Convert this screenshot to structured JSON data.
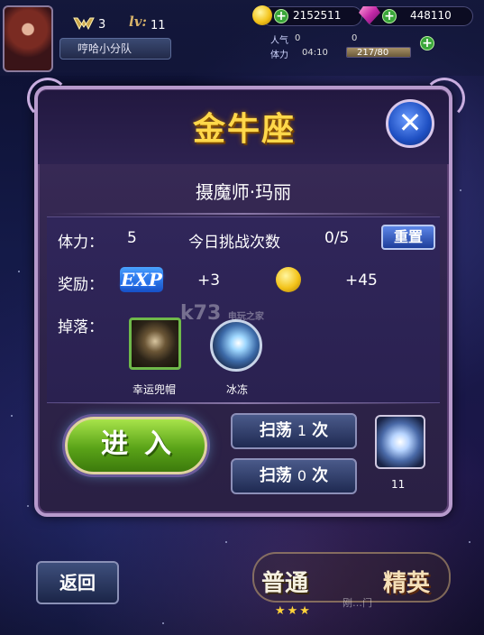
{
  "player": {
    "vip": "3",
    "level_label": "lv:",
    "level": "11",
    "team_name": "哼哈小分队"
  },
  "resources": {
    "gold": "2152511",
    "gems": "448110",
    "popularity_label": "人气",
    "popularity": "0",
    "popularity_extra": "0",
    "stamina_label": "体力",
    "stamina_timer": "04:10",
    "stamina": "217/80",
    "stamina_fill_fraction": 1.0
  },
  "dialog": {
    "title": "金牛座",
    "character": "摄魔师·玛丽",
    "stamina_label": "体力：",
    "stamina_cost": "5",
    "challenges_label": "今日挑战次数",
    "challenges_value": "0/5",
    "reset_button": "重置",
    "reward_label": "奖励：",
    "exp_icon_text": "EXP",
    "exp_value": "+3",
    "gold_value": "+45",
    "drops_label": "掉落：",
    "drops": [
      {
        "name": "幸运兜帽",
        "icon": "hood-icon"
      },
      {
        "name": "冰冻",
        "icon": "ice-skill-icon"
      }
    ],
    "enter_button": "进入",
    "sweep1_prefix": "扫荡",
    "sweep1_count": "1",
    "sweep1_suffix": "次",
    "sweep2_prefix": "扫荡",
    "sweep2_count": "0",
    "sweep2_suffix": "次",
    "ticket_count": "11",
    "close_icon": "✕"
  },
  "bottom": {
    "back_button": "返回",
    "mode_normal": "普通",
    "mode_elite": "精英",
    "stars": "★★★",
    "faded_text": "刚…门"
  },
  "watermark": {
    "logo": "k73",
    "tagline": "电玩之家"
  },
  "colors": {
    "title_gold": "#ffd84a",
    "dialog_border": "#b79acc",
    "enter_green": "#5aa318",
    "button_blue": "#1d3d9a"
  }
}
